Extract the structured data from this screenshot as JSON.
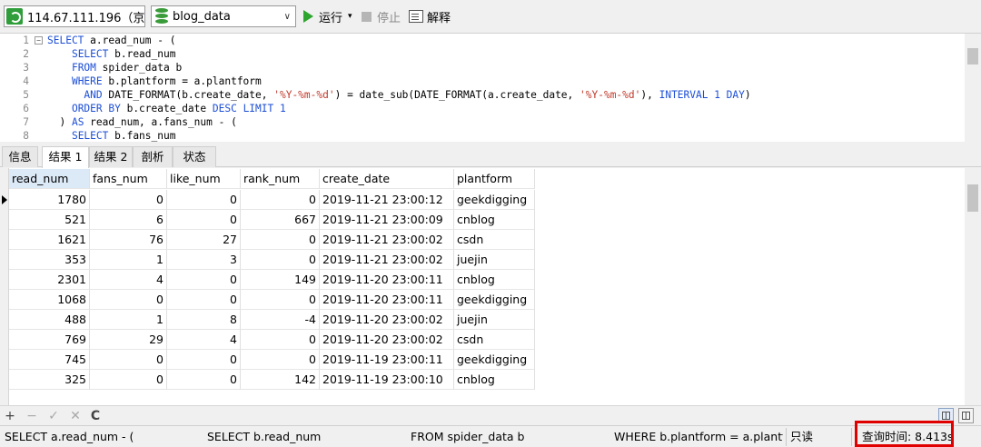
{
  "toolbar": {
    "connection": "114.67.111.196（京东",
    "database": "blog_data",
    "run_label": "运行",
    "stop_label": "停止",
    "explain_label": "解释"
  },
  "editor": {
    "lines": [
      {
        "no": "1",
        "fold": "−",
        "parts": [
          {
            "t": "kw",
            "v": "SELECT"
          },
          {
            "t": "",
            "v": " a.read_num - ("
          }
        ]
      },
      {
        "no": "2",
        "parts": [
          {
            "t": "",
            "v": "    "
          },
          {
            "t": "kw",
            "v": "SELECT"
          },
          {
            "t": "",
            "v": " b.read_num"
          }
        ]
      },
      {
        "no": "3",
        "parts": [
          {
            "t": "",
            "v": "    "
          },
          {
            "t": "kw",
            "v": "FROM"
          },
          {
            "t": "",
            "v": " spider_data b"
          }
        ]
      },
      {
        "no": "4",
        "parts": [
          {
            "t": "",
            "v": "    "
          },
          {
            "t": "kw",
            "v": "WHERE"
          },
          {
            "t": "",
            "v": " b.plantform = a.plantform"
          }
        ]
      },
      {
        "no": "5",
        "parts": [
          {
            "t": "",
            "v": "      "
          },
          {
            "t": "kw",
            "v": "AND"
          },
          {
            "t": "",
            "v": " DATE_FORMAT(b.create_date, "
          },
          {
            "t": "str",
            "v": "'%Y-%m-%d'"
          },
          {
            "t": "",
            "v": ") = date_sub(DATE_FORMAT(a.create_date, "
          },
          {
            "t": "str",
            "v": "'%Y-%m-%d'"
          },
          {
            "t": "",
            "v": "), "
          },
          {
            "t": "kw",
            "v": "INTERVAL 1 DAY"
          },
          {
            "t": "",
            "v": ")"
          }
        ]
      },
      {
        "no": "6",
        "parts": [
          {
            "t": "",
            "v": "    "
          },
          {
            "t": "kw",
            "v": "ORDER BY"
          },
          {
            "t": "",
            "v": " b.create_date "
          },
          {
            "t": "kw",
            "v": "DESC LIMIT 1"
          }
        ]
      },
      {
        "no": "7",
        "parts": [
          {
            "t": "",
            "v": "  ) "
          },
          {
            "t": "kw",
            "v": "AS"
          },
          {
            "t": "",
            "v": " read_num, a.fans_num - ("
          }
        ]
      },
      {
        "no": "8",
        "parts": [
          {
            "t": "",
            "v": "    "
          },
          {
            "t": "kw",
            "v": "SELECT"
          },
          {
            "t": "",
            "v": " b.fans_num"
          }
        ]
      }
    ]
  },
  "tabs": [
    "信息",
    "结果 1",
    "结果 2",
    "剖析",
    "状态"
  ],
  "grid": {
    "columns": [
      "read_num",
      "fans_num",
      "like_num",
      "rank_num",
      "create_date",
      "plantform"
    ],
    "rows": [
      [
        "1780",
        "0",
        "0",
        "0",
        "2019-11-21 23:00:12",
        "geekdigging"
      ],
      [
        "521",
        "6",
        "0",
        "667",
        "2019-11-21 23:00:09",
        "cnblog"
      ],
      [
        "1621",
        "76",
        "27",
        "0",
        "2019-11-21 23:00:02",
        "csdn"
      ],
      [
        "353",
        "1",
        "3",
        "0",
        "2019-11-21 23:00:02",
        "juejin"
      ],
      [
        "2301",
        "4",
        "0",
        "149",
        "2019-11-20 23:00:11",
        "cnblog"
      ],
      [
        "1068",
        "0",
        "0",
        "0",
        "2019-11-20 23:00:11",
        "geekdigging"
      ],
      [
        "488",
        "1",
        "8",
        "-4",
        "2019-11-20 23:00:02",
        "juejin"
      ],
      [
        "769",
        "29",
        "4",
        "0",
        "2019-11-20 23:00:02",
        "csdn"
      ],
      [
        "745",
        "0",
        "0",
        "0",
        "2019-11-19 23:00:11",
        "geekdigging"
      ],
      [
        "325",
        "0",
        "0",
        "142",
        "2019-11-19 23:00:10",
        "cnblog"
      ]
    ]
  },
  "grid_tools": {
    "add": "+",
    "remove": "−",
    "apply": "✓",
    "discard": "✕",
    "refresh": "C"
  },
  "status": {
    "seg1": "SELECT a.read_num - (",
    "seg2": "SELECT b.read_num",
    "seg3": "FROM spider_data b",
    "seg4": "WHERE b.plantform = a.plantform",
    "readonly": "只读",
    "query_time": "查询时间: 8.413s"
  },
  "colors": {
    "keyword": "#1d4fd6",
    "string": "#c0392b",
    "highlight_box": "#e00000",
    "run_green": "#2ea52e"
  }
}
